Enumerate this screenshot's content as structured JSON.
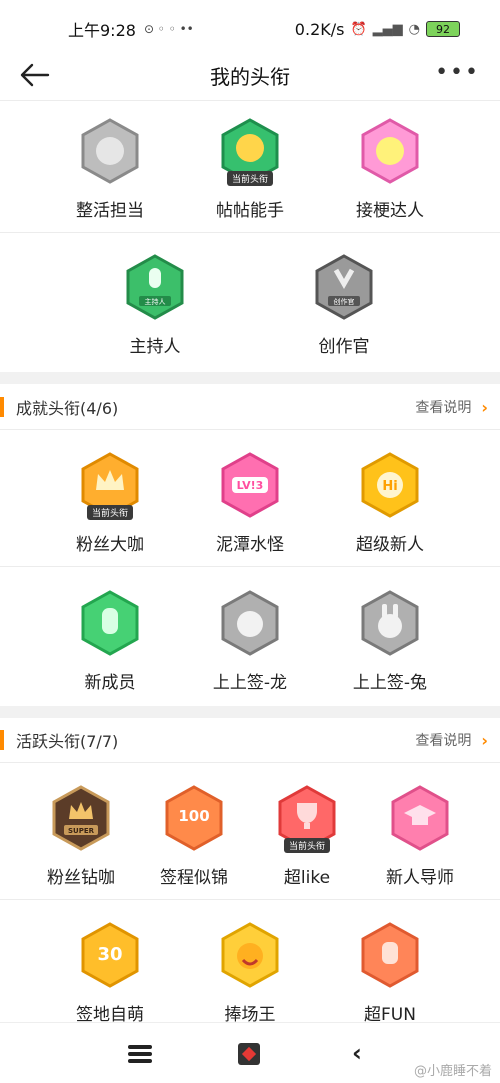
{
  "status": {
    "time": "上午9:28",
    "icons_left": "⊙ ◦ ◦ ••",
    "net_speed": "0.2K/s",
    "battery": "92"
  },
  "header": {
    "title": "我的头衔",
    "more": "•••"
  },
  "current_tag": "当前头衔",
  "group_top": {
    "row1": [
      {
        "label": "整活担当",
        "icon": "gray-character-badge",
        "color": "#b8b8b8",
        "current": false
      },
      {
        "label": "帖帖能手",
        "icon": "green-character-badge",
        "color": "#2fb868",
        "current": true
      },
      {
        "label": "接梗达人",
        "icon": "pink-character-badge",
        "color": "#ff8ad0",
        "current": false
      }
    ],
    "row2": [
      {
        "label": "主持人",
        "icon": "host-microphone-badge",
        "color": "#3cbf6a",
        "sub": "主持人"
      },
      {
        "label": "创作官",
        "icon": "creator-hand-badge",
        "color": "#8f8f8f",
        "sub": "创作官"
      }
    ]
  },
  "section_achievement": {
    "title": "成就头衔(4/6)",
    "link": "查看说明"
  },
  "achievement": {
    "row1": [
      {
        "label": "粉丝大咖",
        "icon": "crown-badge",
        "color": "#ffa928",
        "current": true
      },
      {
        "label": "泥潭水怪",
        "icon": "lv3-badge",
        "color": "#ff5fa8",
        "text": "LV!3"
      },
      {
        "label": "超级新人",
        "icon": "hi-badge",
        "color": "#ffb400",
        "text": "Hi"
      }
    ],
    "row2": [
      {
        "label": "新成员",
        "icon": "hand-wings-badge",
        "color": "#3ccf6a"
      },
      {
        "label": "上上签-龙",
        "icon": "dragon-gray-badge",
        "color": "#a8a8a8"
      },
      {
        "label": "上上签-兔",
        "icon": "rabbit-gray-badge",
        "color": "#a8a8a8"
      }
    ]
  },
  "section_active": {
    "title": "活跃头衔(7/7)",
    "link": "查看说明"
  },
  "active": {
    "row1": [
      {
        "label": "粉丝钻咖",
        "icon": "super-crown-badge",
        "color": "#5b3c28",
        "text": "SUPER"
      },
      {
        "label": "签程似锦",
        "icon": "100-days-badge",
        "color": "#ff7a3a",
        "text": "100"
      },
      {
        "label": "超like",
        "icon": "trophy-badge",
        "color": "#ff5656",
        "current": true
      },
      {
        "label": "新人导师",
        "icon": "grad-cap-badge",
        "color": "#ff6fa0"
      }
    ],
    "row2": [
      {
        "label": "签地自萌",
        "icon": "30-days-badge",
        "color": "#ffb020",
        "text": "30"
      },
      {
        "label": "捧场王",
        "icon": "cheer-face-badge",
        "color": "#ffc83a"
      },
      {
        "label": "超FUN",
        "icon": "rock-hand-badge",
        "color": "#ff7a50"
      }
    ]
  },
  "watermark": "@小鹿睡不着"
}
